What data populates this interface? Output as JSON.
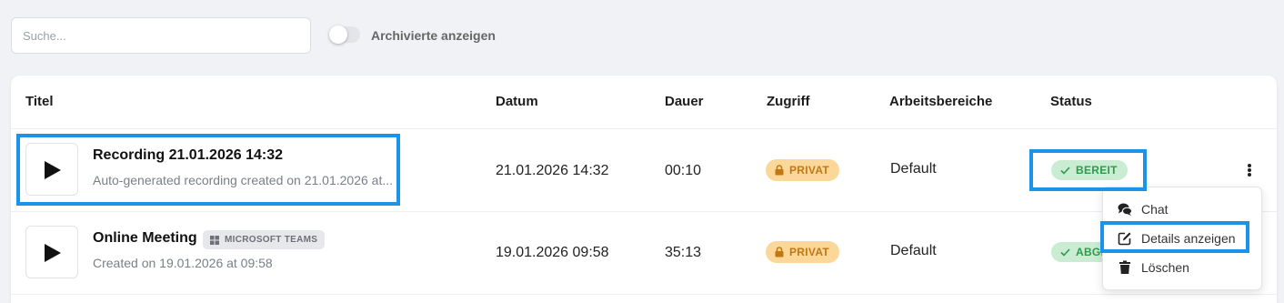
{
  "filters": {
    "search_placeholder": "Suche...",
    "archived_toggle_label": "Archivierte anzeigen",
    "archived_toggle_on": false
  },
  "table": {
    "columns": [
      "Titel",
      "Datum",
      "Dauer",
      "Zugriff",
      "Arbeitsbereiche",
      "Status"
    ],
    "rows": [
      {
        "title": "Recording 21.01.2026 14:32",
        "subtitle": "Auto-generated recording created on 21.01.2026 at...",
        "date": "21.01.2026 14:32",
        "duration": "00:10",
        "access": "PRIVAT",
        "workspace": "Default",
        "status": "BEREIT"
      },
      {
        "title": "Online Meeting",
        "source_badge": "MICROSOFT TEAMS",
        "subtitle": "Created on 19.01.2026 at 09:58",
        "date": "19.01.2026 09:58",
        "duration": "35:13",
        "access": "PRIVAT",
        "workspace": "Default",
        "status": "ABGE"
      }
    ]
  },
  "context_menu": {
    "items": [
      {
        "label": "Chat",
        "icon": "comments-icon"
      },
      {
        "label": "Details anzeigen",
        "icon": "edit-icon"
      },
      {
        "label": "Löschen",
        "icon": "trash-icon"
      }
    ]
  },
  "colors": {
    "highlight": "#1a93e8",
    "private_badge_bg": "#fbd79a",
    "private_badge_text": "#c27812",
    "ready_badge_bg": "#c9ecd2",
    "ready_badge_text": "#2f9a4c"
  }
}
